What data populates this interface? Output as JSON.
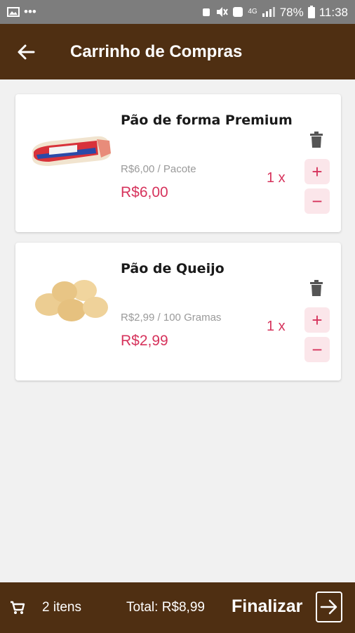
{
  "status": {
    "battery": "78%",
    "time": "11:38",
    "network": "4G"
  },
  "header": {
    "title": "Carrinho de Compras"
  },
  "items": [
    {
      "name": "Pão de forma Premium",
      "unit_price": "R$6,00 / Pacote",
      "total": "R$6,00",
      "qty": "1 x",
      "image": "bread-loaf-image"
    },
    {
      "name": "Pão de Queijo",
      "unit_price": "R$2,99 / 100 Gramas",
      "total": "R$2,99",
      "qty": "1 x",
      "image": "cheese-bread-image"
    }
  ],
  "controls": {
    "plus": "+",
    "minus": "−"
  },
  "footer": {
    "count": "2 itens",
    "total": "Total: R$8,99",
    "checkout": "Finalizar"
  },
  "colors": {
    "brand": "#4f2f12",
    "accent": "#d6335c",
    "status_bar": "#7d7d7d",
    "background": "#f1f1f1"
  }
}
